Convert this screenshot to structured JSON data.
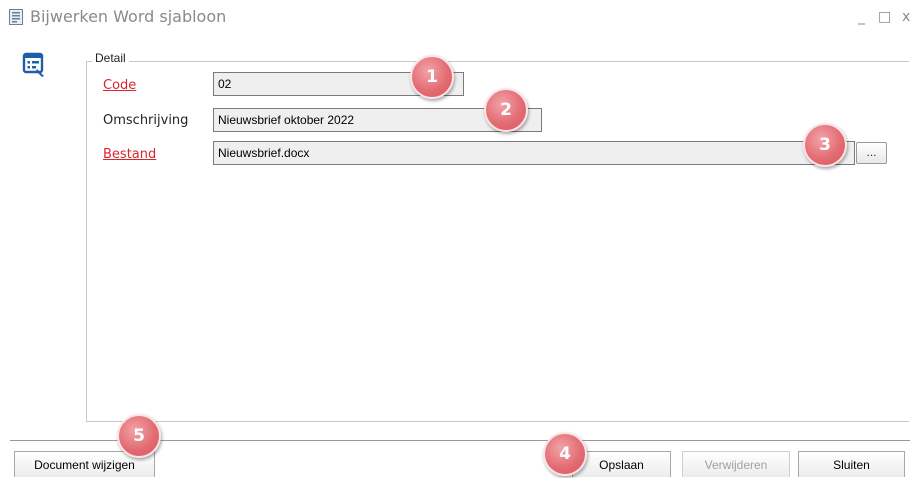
{
  "window": {
    "title": "Bijwerken Word sjabloon",
    "controls": {
      "minimize": "_",
      "maximize": "□",
      "close": "x"
    }
  },
  "detail": {
    "legend": "Detail",
    "fields": {
      "code": {
        "label": "Code",
        "value": "02",
        "required": true
      },
      "omschrijving": {
        "label": "Omschrijving",
        "value": "Nieuwsbrief oktober 2022",
        "required": false
      },
      "bestand": {
        "label": "Bestand",
        "value": "Nieuwsbrief.docx",
        "required": true,
        "browse_label": "..."
      }
    }
  },
  "buttons": {
    "document_wijzigen": "Document wijzigen",
    "opslaan": "Opslaan",
    "verwijderen": "Verwijderen",
    "sluiten": "Sluiten"
  },
  "markers": [
    "1",
    "2",
    "3",
    "4",
    "5"
  ],
  "colors": {
    "required_label": "#d8262c",
    "marker": "#e36d74",
    "icon_blue": "#1f5fa8",
    "disabled_text": "#a0a0a0"
  },
  "icons": {
    "title": "document-icon",
    "form": "form-edit-icon"
  }
}
